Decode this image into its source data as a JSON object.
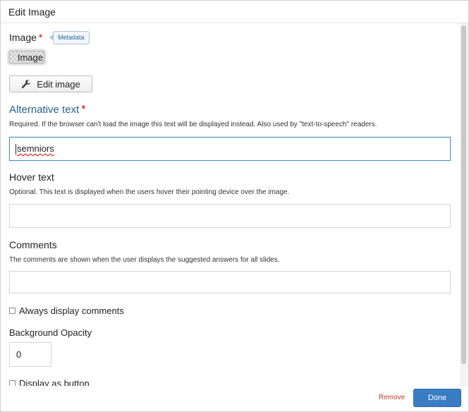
{
  "dialog": {
    "title": "Edit Image"
  },
  "image_field": {
    "label": "Image",
    "required_mark": "*",
    "metadata_label": "Metadata",
    "thumbnail_text": "Image",
    "edit_button_label": "Edit image"
  },
  "alt_text": {
    "label": "Alternative text",
    "required_mark": "*",
    "description": "Required. If the browser can't load the image this text will be displayed instead. Also used by \"text-to-speech\" readers.",
    "value": "semniors"
  },
  "hover_text": {
    "label": "Hover text",
    "description": "Optional. This text is displayed when the users hover their pointing device over the image.",
    "value": ""
  },
  "comments": {
    "label": "Comments",
    "description": "The comments are shown when the user displays the suggested answers for all slides.",
    "value": ""
  },
  "always_display_comments": {
    "label": "Always display comments",
    "checked": false
  },
  "background_opacity": {
    "label": "Background Opacity",
    "value": "0"
  },
  "display_as_button": {
    "label": "Display as button"
  },
  "footer": {
    "remove_label": "Remove",
    "done_label": "Done"
  },
  "colors": {
    "accent_blue": "#3a7cc4",
    "label_blue": "#2b5f8e",
    "required_red": "#d40000",
    "remove_red": "#c0392b"
  }
}
